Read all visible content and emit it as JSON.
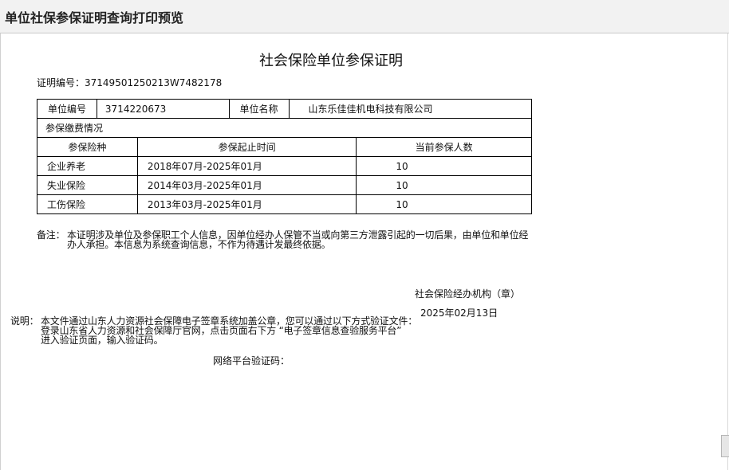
{
  "window": {
    "title": "单位社保参保证明查询打印预览"
  },
  "document": {
    "title": "社会保险单位参保证明",
    "cert_label": "证明编号：",
    "cert_no": "37149501250213W7482178",
    "unit": {
      "code_label": "单位编号",
      "code": "3714220673",
      "name_label": "单位名称",
      "name": "山东乐佳佳机电科技有限公司"
    },
    "section_label": "参保缴费情况",
    "columns": [
      "参保险种",
      "参保起止时间",
      "当前参保人数"
    ],
    "rows": [
      {
        "type": "企业养老",
        "period": "2018年07月-2025年01月",
        "count": "10"
      },
      {
        "type": "失业保险",
        "period": "2014年03月-2025年01月",
        "count": "10"
      },
      {
        "type": "工伤保险",
        "period": "2013年03月-2025年01月",
        "count": "10"
      }
    ],
    "note_label": "备注：",
    "note_text": "本证明涉及单位及参保职工个人信息，因单位经办人保管不当或向第三方泄露引起的一切后果，由单位和单位经办人承担。本信息为系统查询信息，不作为待遇计发最终依据。",
    "agency": "社会保险经办机构（章）",
    "date": "2025年02月13日",
    "explain_label": "说明：",
    "explain_lines": [
      "本文件通过山东人力资源社会保障电子签章系统加盖公章，您可以通过以下方式验证文件：",
      "登录山东省人力资源和社会保障厅官网，点击页面右下方 “电子签章信息查验服务平台”",
      "进入验证页面，输入验证码。"
    ],
    "verify_label": "网络平台验证码："
  }
}
